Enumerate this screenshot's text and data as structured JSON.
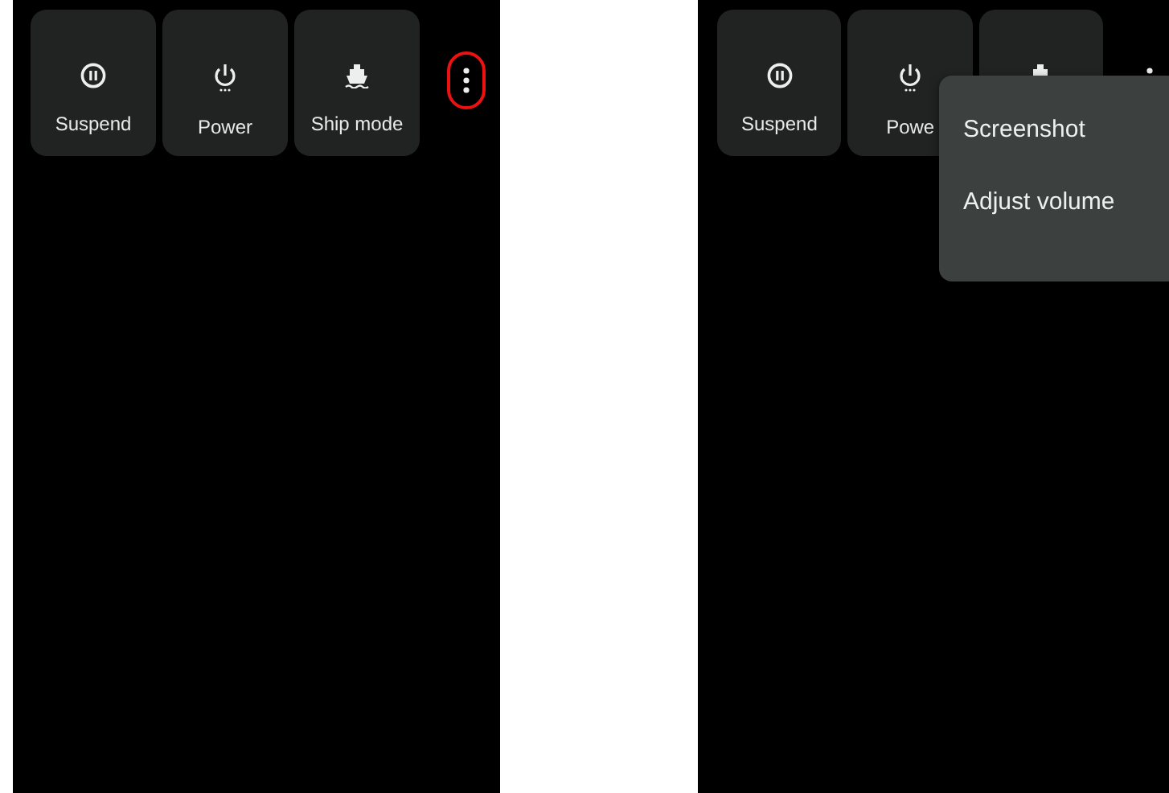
{
  "screens": [
    {
      "tiles": [
        {
          "kind": "pause",
          "label": "Suspend"
        },
        {
          "kind": "power",
          "label": "Power"
        },
        {
          "kind": "ship",
          "label": "Ship mode"
        }
      ],
      "overflow_highlighted": true
    },
    {
      "tiles": [
        {
          "kind": "pause",
          "label": "Suspend"
        },
        {
          "kind": "power",
          "label": "Powe"
        },
        {
          "kind": "ship"
        }
      ],
      "overflow_highlighted": false,
      "menu": {
        "items": [
          "Screenshot",
          "Adjust volume"
        ]
      }
    }
  ]
}
